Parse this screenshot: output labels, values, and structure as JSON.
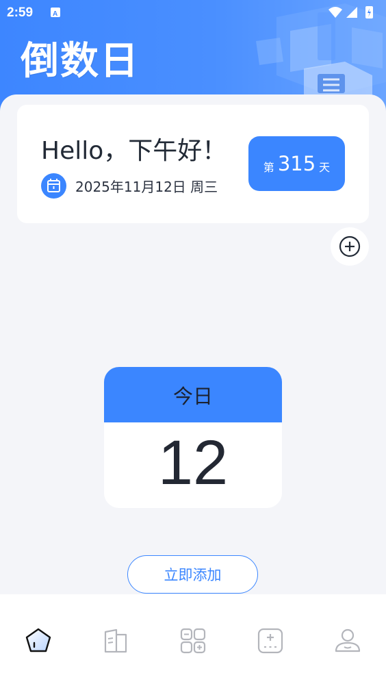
{
  "status_bar": {
    "time": "2:59",
    "icons": [
      "notification-a-icon",
      "wifi-icon",
      "signal-icon",
      "battery-charging-icon"
    ]
  },
  "header": {
    "title": "倒数日"
  },
  "greeting_card": {
    "greeting": "Hello，下午好！",
    "date": "2025年11月12日  周三",
    "day_prefix": "第",
    "day_number": "315",
    "day_suffix": "天"
  },
  "calendar": {
    "header": "今日",
    "day": "12"
  },
  "add_button": {
    "label": "立即添加"
  },
  "bottom_nav": {
    "items": [
      {
        "icon": "home-pentagon-icon",
        "active": true
      },
      {
        "icon": "book-icon",
        "active": false
      },
      {
        "icon": "grid-tools-icon",
        "active": false
      },
      {
        "icon": "calculator-icon",
        "active": false
      },
      {
        "icon": "profile-icon",
        "active": false
      }
    ]
  },
  "colors": {
    "primary": "#3b86ff",
    "background": "#f4f5f9",
    "text": "#222a36",
    "nav_inactive": "#b3b5bb"
  }
}
